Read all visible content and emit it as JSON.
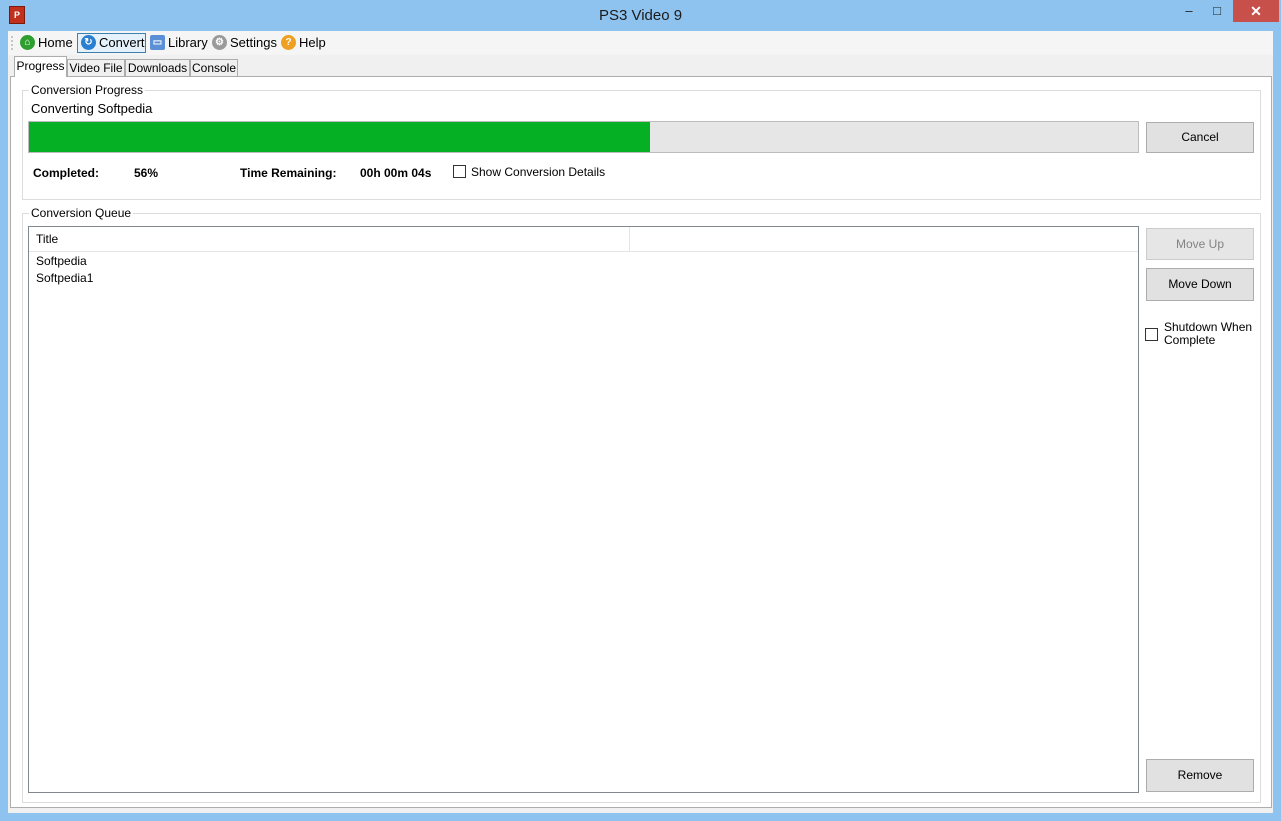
{
  "window": {
    "title": "PS3 Video 9",
    "app_icon_glyph": "P",
    "minimize_glyph": "–",
    "maximize_glyph": "□",
    "close_glyph": "✕"
  },
  "menu": {
    "items": [
      {
        "label": "Home",
        "icon": "home-icon",
        "color": "#2e9e2e",
        "glyph": "⌂"
      },
      {
        "label": "Convert",
        "icon": "convert-icon",
        "color": "#2a7fd0",
        "glyph": "↻"
      },
      {
        "label": "Library",
        "icon": "folder-icon",
        "color": "#5b8fd6",
        "glyph": "▭"
      },
      {
        "label": "Settings",
        "icon": "gear-icon",
        "color": "#9a9a9a",
        "glyph": "⚙"
      },
      {
        "label": "Help",
        "icon": "help-icon",
        "color": "#f0a020",
        "glyph": "?"
      }
    ]
  },
  "tabs": [
    "Progress",
    "Video File",
    "Downloads",
    "Console"
  ],
  "progress_group": {
    "legend": "Conversion Progress",
    "status": "Converting Softpedia",
    "progress_percent": 56,
    "cancel_label": "Cancel",
    "completed_label": "Completed:",
    "completed_value": "56%",
    "time_remaining_label": "Time Remaining:",
    "time_remaining_value": "00h 00m 04s",
    "show_details_label": "Show Conversion Details",
    "accent_color": "#06b025"
  },
  "queue_group": {
    "legend": "Conversion Queue",
    "column_title": "Title",
    "rows": [
      "Softpedia",
      "Softpedia1"
    ],
    "move_up_label": "Move Up",
    "move_down_label": "Move Down",
    "shutdown_label_line1": "Shutdown When",
    "shutdown_label_line2": "Complete",
    "remove_label": "Remove"
  }
}
